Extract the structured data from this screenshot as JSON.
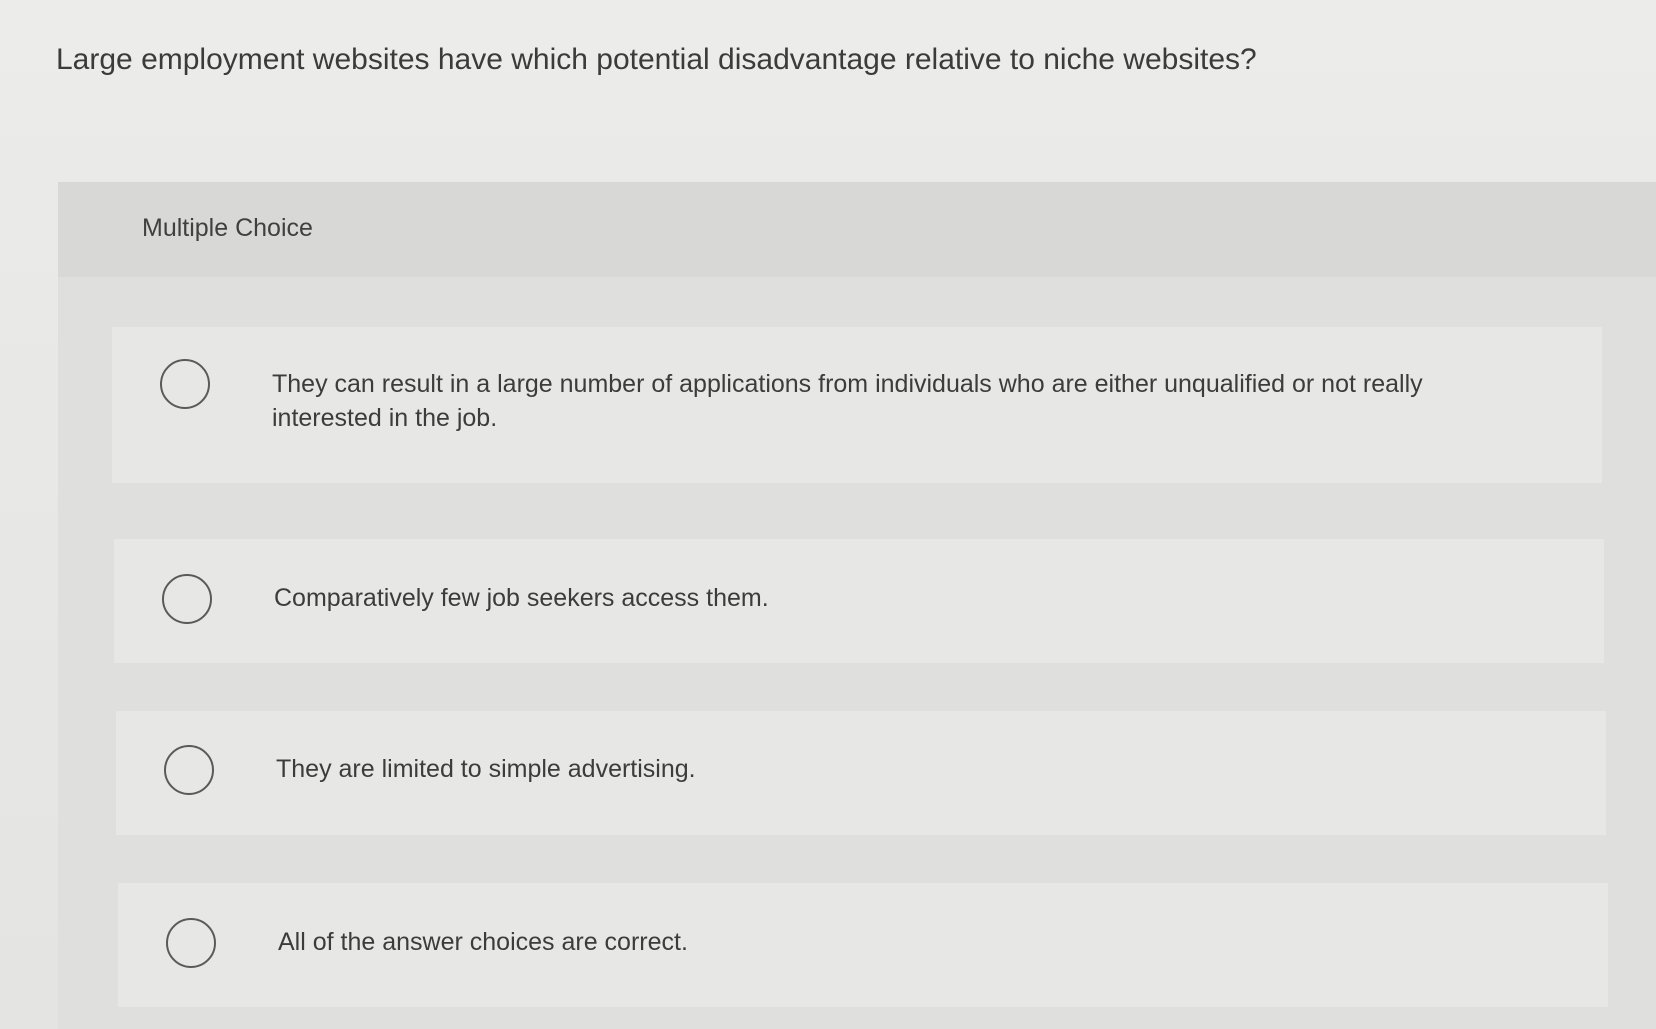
{
  "question": {
    "text": "Large employment websites have which potential disadvantage relative to niche websites?"
  },
  "multiple_choice": {
    "label": "Multiple Choice",
    "options": [
      {
        "text": "They can result in a large number of applications from individuals who are either unqualified or not really interested in the job.",
        "selected": false
      },
      {
        "text": "Comparatively few job seekers access them.",
        "selected": false
      },
      {
        "text": "They are limited to simple advertising.",
        "selected": false
      },
      {
        "text": "All of the answer choices are correct.",
        "selected": false
      }
    ]
  },
  "icons": {
    "radio": "radio-unchecked-icon"
  }
}
